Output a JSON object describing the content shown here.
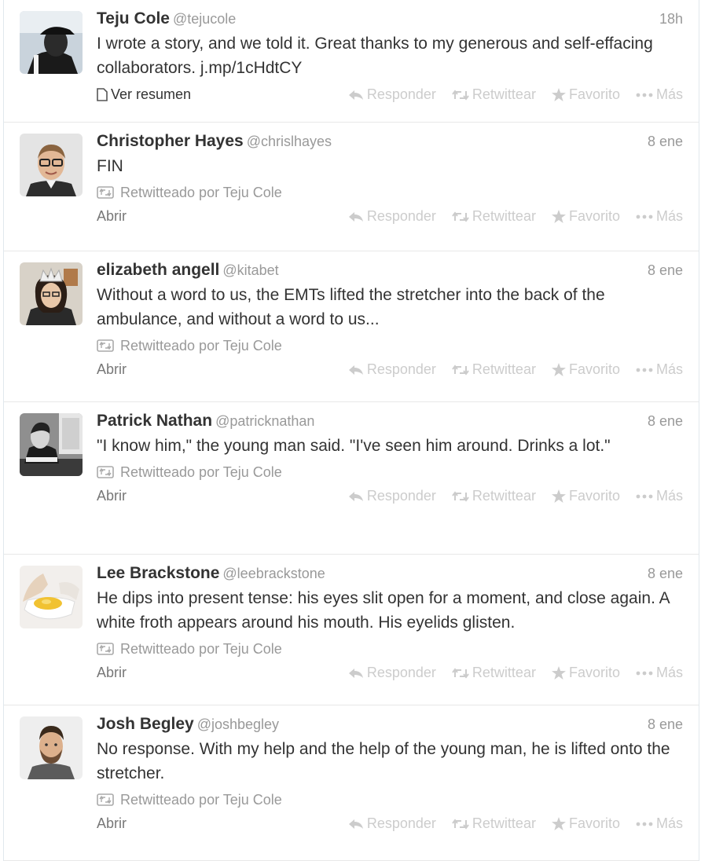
{
  "actions": {
    "reply": "Responder",
    "retweet": "Retwittear",
    "favorite": "Favorito",
    "more": "Más"
  },
  "tweets": [
    {
      "fullname": "Teju Cole",
      "username": "@tejucole",
      "time": "18h",
      "text": "I wrote a story, and we told it. Great thanks to my generous and self-effacing collaborators. j.mp/1cHdtCY",
      "expand": "Ver resumen",
      "avatar_icon": "person-in-cap-avatar"
    },
    {
      "fullname": "Christopher Hayes",
      "username": "@chrislhayes",
      "time": "8 ene",
      "text": "FIN",
      "retweeted_by": "Retwitteado por Teju Cole",
      "expand": "Abrir",
      "avatar_icon": "man-with-glasses-avatar"
    },
    {
      "fullname": "elizabeth angell",
      "username": "@kitabet",
      "time": "8 ene",
      "text": "Without a word to us, the EMTs lifted the stretcher into the back of the ambulance, and without a word to us...",
      "retweeted_by": "Retwitteado por Teju Cole",
      "expand": "Abrir",
      "avatar_icon": "woman-with-crown-avatar"
    },
    {
      "fullname": "Patrick Nathan",
      "username": "@patricknathan",
      "time": "8 ene",
      "text": "\"I know him,\" the young man said. \"I've seen him around. Drinks a lot.\"",
      "retweeted_by": "Retwitteado por Teju Cole",
      "expand": "Abrir",
      "avatar_icon": "man-at-desk-avatar"
    },
    {
      "fullname": "Lee Brackstone",
      "username": "@leebrackstone",
      "time": "8 ene",
      "text": "He dips into present tense: his eyes slit open for a moment, and close again. A white froth appears around his mouth. His eyelids glisten.",
      "retweeted_by": "Retwitteado por Teju Cole",
      "expand": "Abrir",
      "avatar_icon": "cracked-egg-avatar"
    },
    {
      "fullname": "Josh Begley",
      "username": "@joshbegley",
      "time": "8 ene",
      "text": "No response. With my help and the help of the young man, he is lifted onto the stretcher.",
      "retweeted_by": "Retwitteado por Teju Cole",
      "expand": "Abrir",
      "avatar_icon": "bearded-man-avatar"
    }
  ]
}
